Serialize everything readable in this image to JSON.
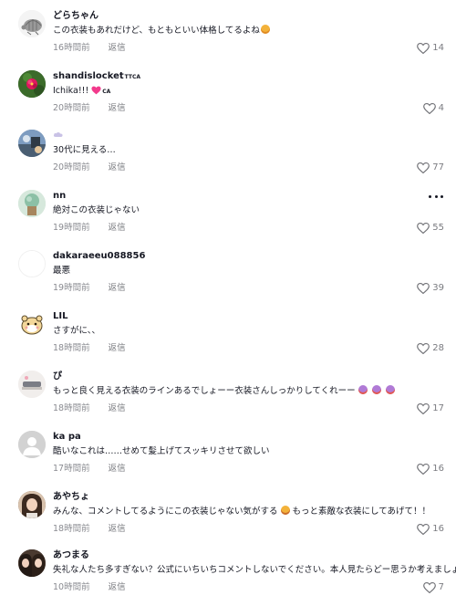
{
  "comments": [
    {
      "username": "どらちゃん",
      "text": "この衣装もあれだけど、もともといい体格してるよね",
      "time": "16時間前",
      "reply": "返信",
      "likes": "14",
      "avatar_icon": "armadillo-avatar"
    },
    {
      "username": "shandislocket",
      "badge": "TTCA",
      "text": "Ichika!!!",
      "suffix": "CA",
      "time": "20時間前",
      "reply": "返信",
      "likes": "4",
      "avatar_icon": "flower-avatar"
    },
    {
      "username": "",
      "text": "30代に見える…",
      "time": "20時間前",
      "reply": "返信",
      "likes": "77",
      "avatar_icon": "cloud-avatar"
    },
    {
      "username": "nn",
      "text": "絶対この衣装じゃない",
      "time": "19時間前",
      "reply": "返信",
      "likes": "55",
      "avatar_icon": "plant-avatar"
    },
    {
      "username": "dakaraeeu088856",
      "text": "最悪",
      "time": "19時間前",
      "reply": "返信",
      "likes": "39",
      "avatar_icon": "blank-avatar"
    },
    {
      "username": "LIL",
      "text": "さすがに、、",
      "time": "18時間前",
      "reply": "返信",
      "likes": "28",
      "avatar_icon": "hamster-avatar"
    },
    {
      "username": "ぴ",
      "text": "もっと良く見える衣装のラインあるでしょーー衣装さんしっかりしてくれーー",
      "time": "18時間前",
      "reply": "返信",
      "likes": "17",
      "avatar_icon": "photo-avatar"
    },
    {
      "username": "ka pa",
      "text": "酷いなこれは……せめて髪上げてスッキリさせて欲しい",
      "time": "17時間前",
      "reply": "返信",
      "likes": "16",
      "avatar_icon": "default-user-avatar"
    },
    {
      "username": "あやちょ",
      "text": "みんな、コメントしてるようにこの衣装じゃない気がする",
      "text2": "もっと素敵な衣装にしてあげて！！",
      "time": "18時間前",
      "reply": "返信",
      "likes": "16",
      "avatar_icon": "portrait-avatar"
    },
    {
      "username": "あつまる",
      "text": "失礼な人たち多すぎない？公式にいちいちコメントしないでください。本人見たらどー思うか考えましょう。",
      "time": "10時間前",
      "reply": "返信",
      "likes": "7",
      "avatar_icon": "duo-portrait-avatar"
    }
  ],
  "colors": {
    "text": "#161823",
    "meta": "#8a8b91",
    "heart_pink": "#fe2c55"
  }
}
